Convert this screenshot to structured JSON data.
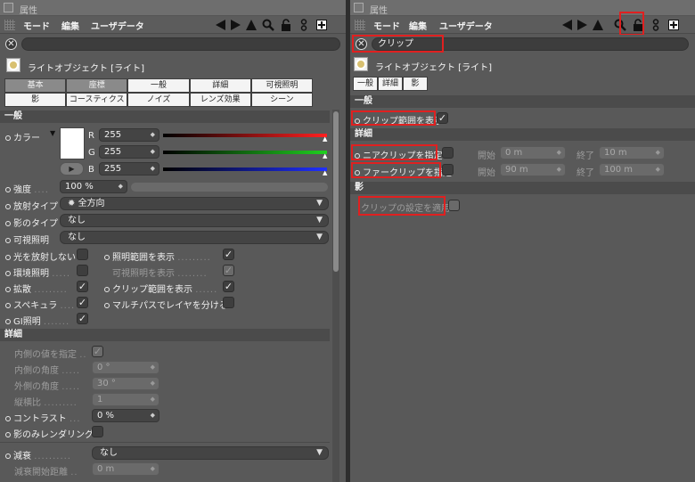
{
  "left": {
    "window_title": "属性",
    "menu": {
      "mode": "モード",
      "edit": "編集",
      "userdata": "ユーザデータ"
    },
    "search_value": "",
    "object_title": "ライトオブジェクト [ライト]",
    "tabs_row1": [
      "基本",
      "座標",
      "一般",
      "詳細",
      "可視照明"
    ],
    "tabs_row2": [
      "影",
      "コースティクス",
      "ノイズ",
      "レンズ効果",
      "シーン"
    ],
    "sections": {
      "general": "一般",
      "details": "詳細"
    },
    "color": {
      "label": "カラー",
      "r_label": "R",
      "g_label": "G",
      "b_label": "B",
      "r": "255",
      "g": "255",
      "b": "255"
    },
    "intensity": {
      "label": "強度",
      "value": "100 %"
    },
    "emission_type": {
      "label": "放射タイプ",
      "value": "全方向"
    },
    "shadow_type": {
      "label": "影のタイプ",
      "value": "なし"
    },
    "visible_light": {
      "label": "可視照明",
      "value": "なし"
    },
    "checks_left": [
      {
        "label": "光を放射しない",
        "checked": false
      },
      {
        "label": "環境照明",
        "checked": false
      },
      {
        "label": "拡散",
        "checked": true
      },
      {
        "label": "スペキュラ",
        "checked": true
      },
      {
        "label": "GI照明",
        "checked": true
      }
    ],
    "checks_right": [
      {
        "label": "照明範囲を表示",
        "checked": true
      },
      {
        "label": "可視照明を表示",
        "checked": true
      },
      {
        "label": "クリップ範囲を表示",
        "checked": true
      },
      {
        "label": "マルチパスでレイヤを分ける",
        "checked": false
      }
    ],
    "details": {
      "inner_value": {
        "label": "内側の値を指定",
        "checked": true
      },
      "inner_angle": {
        "label": "内側の角度",
        "value": "0 °"
      },
      "outer_angle": {
        "label": "外側の角度",
        "value": "30 °"
      },
      "aspect": {
        "label": "縦横比",
        "value": "1"
      },
      "contrast": {
        "label": "コントラスト",
        "value": "0 %"
      },
      "shadow_only": {
        "label": "影のみレンダリング",
        "checked": false
      },
      "falloff": {
        "label": "減衰",
        "value": "なし"
      },
      "falloff_start": {
        "label": "減衰開始距離",
        "value": "0 m"
      }
    }
  },
  "right": {
    "window_title": "属性",
    "menu": {
      "mode": "モード",
      "edit": "編集",
      "userdata": "ユーザデータ"
    },
    "search_value": "クリップ",
    "object_title": "ライトオブジェクト [ライト]",
    "tabs": [
      "一般",
      "詳細",
      "影"
    ],
    "sections": {
      "general": "一般",
      "details": "詳細",
      "shadow": "影"
    },
    "show_clip": {
      "label": "クリップ範囲を表示",
      "checked": true
    },
    "near_clip": {
      "label": "ニアクリップを指定",
      "checked": false,
      "start_label": "開始",
      "start": "0 m",
      "end_label": "終了",
      "end": "10 m"
    },
    "far_clip": {
      "label": "ファークリップを指定",
      "checked": false,
      "start_label": "開始",
      "start": "90 m",
      "end_label": "終了",
      "end": "100 m"
    },
    "apply_clip": {
      "label": "クリップの設定を適用",
      "checked": false
    }
  },
  "colors": {
    "highlight": "#e02020",
    "red": "#ff2020",
    "green": "#20d020",
    "blue": "#2030ff"
  }
}
